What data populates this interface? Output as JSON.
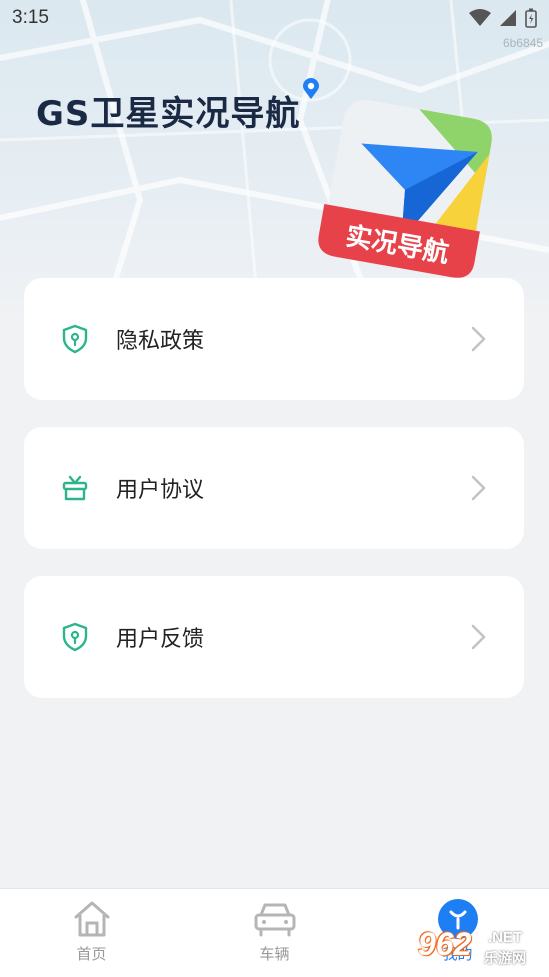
{
  "status_bar": {
    "time": "3:15"
  },
  "watermark_top": "6b6845",
  "brand": {
    "title": "GS卫星实况导航",
    "logo_badge_text": "实况导航"
  },
  "menu": [
    {
      "label": "隐私政策",
      "icon": "shield-icon"
    },
    {
      "label": "用户协议",
      "icon": "gift-icon"
    },
    {
      "label": "用户反馈",
      "icon": "shield-icon"
    }
  ],
  "bottom_nav": [
    {
      "label": "首页",
      "icon": "home-icon",
      "active": false
    },
    {
      "label": "车辆",
      "icon": "car-icon",
      "active": false
    },
    {
      "label": "我的",
      "icon": "user-icon",
      "active": true
    }
  ],
  "watermark_bottom": {
    "number": "962",
    "net": ".NET",
    "cn": "乐游网"
  },
  "colors": {
    "accent": "#1e7ef4",
    "icon_green": "#2cb58d",
    "card_bg": "#ffffff",
    "page_bg": "#f1f2f4"
  }
}
